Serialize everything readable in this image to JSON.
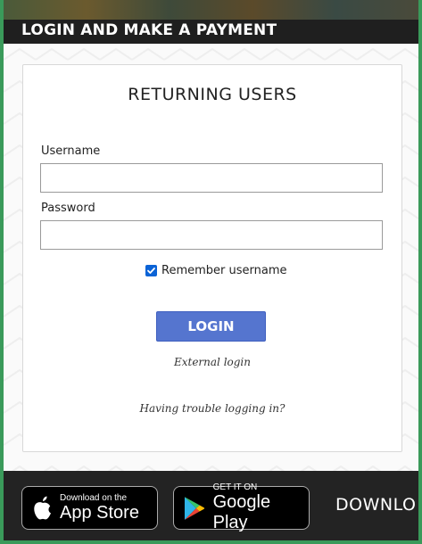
{
  "header": {
    "title": "LOGIN AND MAKE A PAYMENT"
  },
  "login": {
    "title": "RETURNING USERS",
    "username_label": "Username",
    "username_value": "",
    "password_label": "Password",
    "password_value": "",
    "remember_label": "Remember username",
    "remember_checked": true,
    "login_button": "LOGIN",
    "external_login": "External login",
    "trouble_link": "Having trouble logging in?"
  },
  "footer": {
    "app_store_small": "Download on the",
    "app_store_big": "App Store",
    "google_play_small": "GET IT ON",
    "google_play_big": "Google Play",
    "download_text": "DOWNLO"
  },
  "colors": {
    "accent": "#5575cf",
    "checkbox": "#0b63d6",
    "border_green": "#3a9a5a"
  }
}
